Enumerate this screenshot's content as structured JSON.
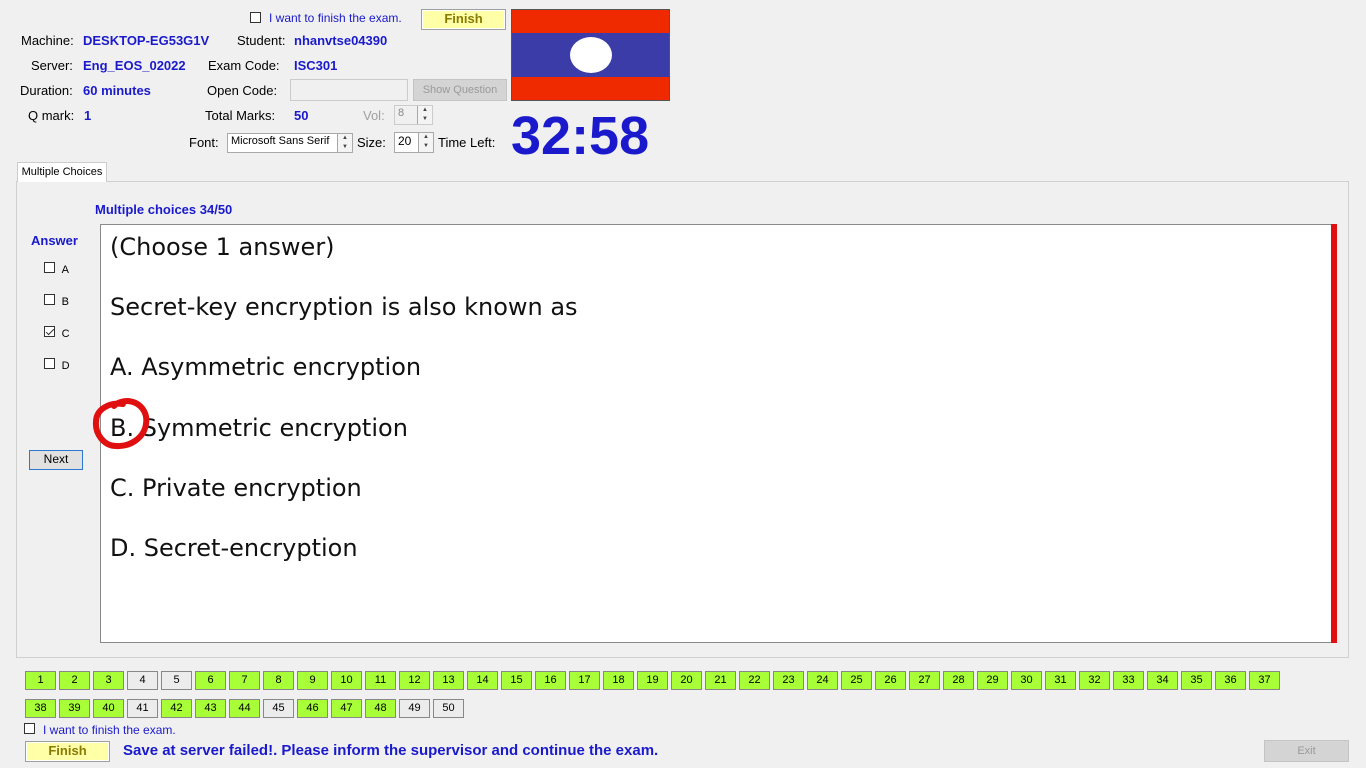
{
  "header": {
    "finish_top_label": "I want to finish the exam.",
    "finish_button": "Finish",
    "machine_label": "Machine:",
    "machine": "DESKTOP-EG53G1V",
    "student_label": "Student:",
    "student": "nhanvtse04390",
    "server_label": "Server:",
    "server": "Eng_EOS_02022",
    "exam_code_label": "Exam Code:",
    "exam_code": "ISC301",
    "duration_label": "Duration:",
    "duration": "60 minutes",
    "open_code_label": "Open Code:",
    "open_code_value": "",
    "show_question": "Show Question",
    "qmark_label": "Q mark:",
    "qmark": "1",
    "total_marks_label": "Total Marks:",
    "total_marks": "50",
    "vol_label": "Vol:",
    "vol": "8",
    "font_label": "Font:",
    "font_value": "Microsoft Sans Serif",
    "size_label": "Size:",
    "size_value": "20",
    "time_left_label": "Time Left:",
    "time_left": "32:58",
    "flag_colors": {
      "red": "#f02a00",
      "blue": "#3c3ca8",
      "white": "#ffffff"
    }
  },
  "tab": {
    "label": "Multiple Choices"
  },
  "question": {
    "counter": "Multiple choices 34/50",
    "answer_heading": "Answer",
    "options": [
      {
        "letter": "A",
        "checked": false
      },
      {
        "letter": "B",
        "checked": false
      },
      {
        "letter": "C",
        "checked": true
      },
      {
        "letter": "D",
        "checked": false
      }
    ],
    "next_button": "Next",
    "lines": [
      "(Choose 1 answer)",
      "Secret-key encryption is also known as",
      "A.  Asymmetric encryption",
      "B.  Symmetric encryption",
      "C.  Private encryption",
      "D.  Secret-encryption"
    ]
  },
  "nav": {
    "row1": [
      {
        "n": "1",
        "done": true
      },
      {
        "n": "2",
        "done": true
      },
      {
        "n": "3",
        "done": true
      },
      {
        "n": "4",
        "done": false
      },
      {
        "n": "5",
        "done": false
      },
      {
        "n": "6",
        "done": true
      },
      {
        "n": "7",
        "done": true
      },
      {
        "n": "8",
        "done": true
      },
      {
        "n": "9",
        "done": true
      },
      {
        "n": "10",
        "done": true
      },
      {
        "n": "11",
        "done": true
      },
      {
        "n": "12",
        "done": true
      },
      {
        "n": "13",
        "done": true
      },
      {
        "n": "14",
        "done": true
      },
      {
        "n": "15",
        "done": true
      },
      {
        "n": "16",
        "done": true
      },
      {
        "n": "17",
        "done": true
      },
      {
        "n": "18",
        "done": true
      },
      {
        "n": "19",
        "done": true
      },
      {
        "n": "20",
        "done": true
      },
      {
        "n": "21",
        "done": true
      },
      {
        "n": "22",
        "done": true
      },
      {
        "n": "23",
        "done": true
      },
      {
        "n": "24",
        "done": true
      },
      {
        "n": "25",
        "done": true
      },
      {
        "n": "26",
        "done": true
      },
      {
        "n": "27",
        "done": true
      },
      {
        "n": "28",
        "done": true
      },
      {
        "n": "29",
        "done": true
      },
      {
        "n": "30",
        "done": true
      },
      {
        "n": "31",
        "done": true
      },
      {
        "n": "32",
        "done": true
      },
      {
        "n": "33",
        "done": true
      },
      {
        "n": "34",
        "done": true
      },
      {
        "n": "35",
        "done": true
      },
      {
        "n": "36",
        "done": true
      },
      {
        "n": "37",
        "done": true
      }
    ],
    "row2": [
      {
        "n": "38",
        "done": true
      },
      {
        "n": "39",
        "done": true
      },
      {
        "n": "40",
        "done": true
      },
      {
        "n": "41",
        "done": false
      },
      {
        "n": "42",
        "done": true
      },
      {
        "n": "43",
        "done": true
      },
      {
        "n": "44",
        "done": true
      },
      {
        "n": "45",
        "done": false
      },
      {
        "n": "46",
        "done": true
      },
      {
        "n": "47",
        "done": true
      },
      {
        "n": "48",
        "done": true
      },
      {
        "n": "49",
        "done": false
      },
      {
        "n": "50",
        "done": false
      }
    ]
  },
  "footer": {
    "finish_label": "I want to finish the exam.",
    "finish_button": "Finish",
    "status": "Save at server failed!. Please inform the supervisor and continue the exam.",
    "exit_button": "Exit"
  },
  "colors": {
    "accent_blue": "#1a1acc",
    "answered": "#a8ff38",
    "unanswered": "#ececec",
    "scroll_red": "#e01010",
    "annotation_red": "#e01010"
  }
}
